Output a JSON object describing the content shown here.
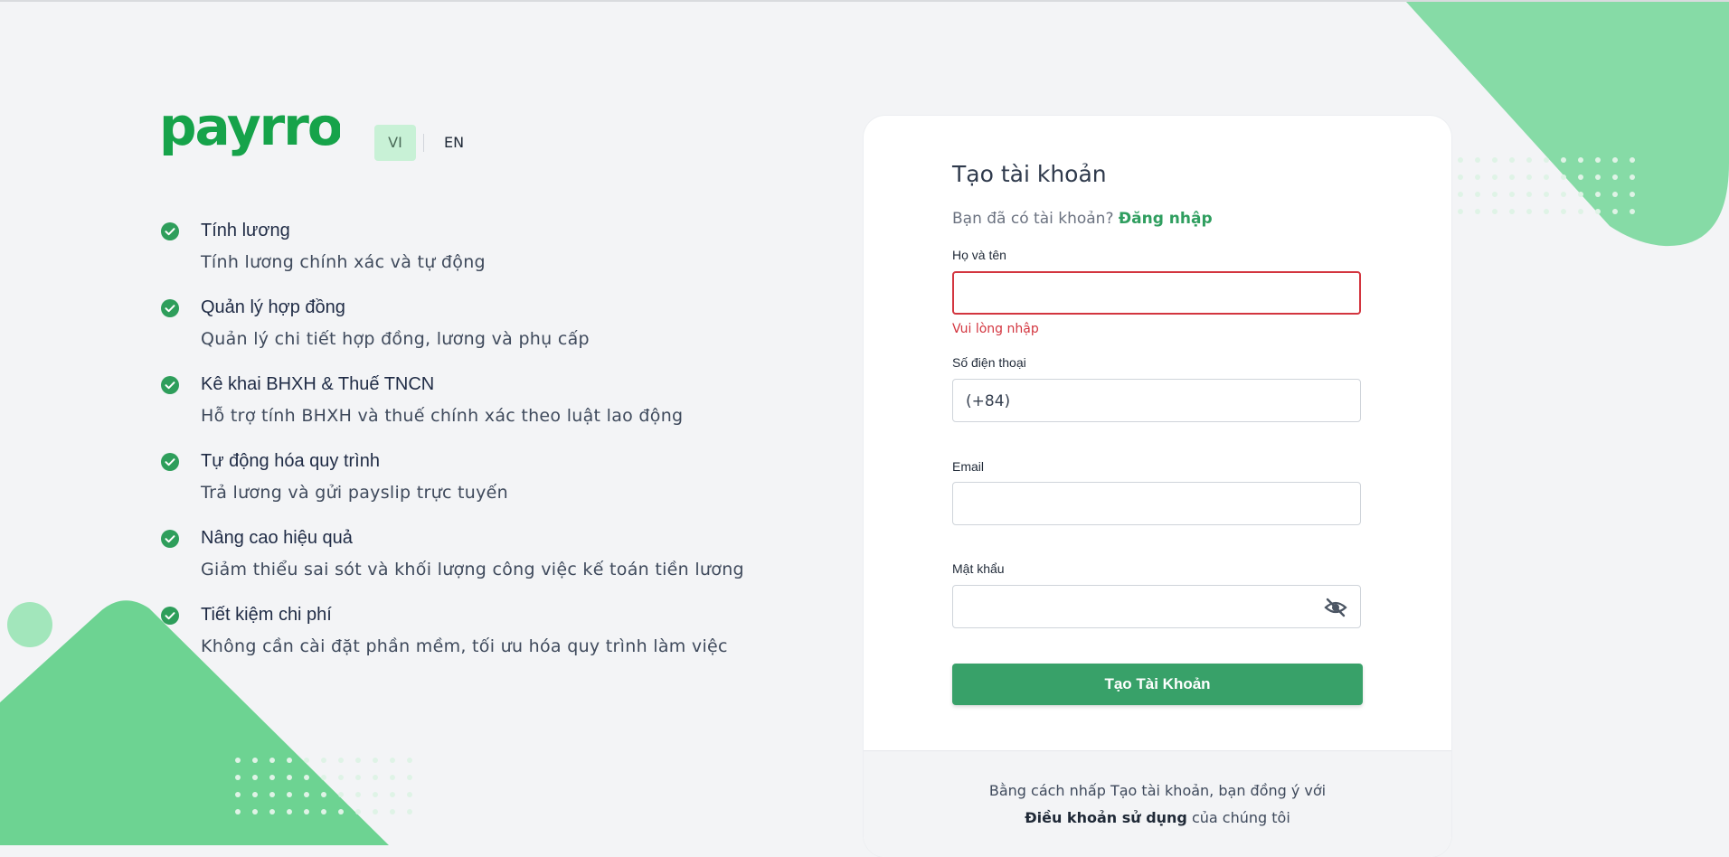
{
  "brand": {
    "logo_text": "payrro",
    "color": "#16a34a"
  },
  "language": {
    "vi": "VI",
    "en": "EN",
    "active": "VI"
  },
  "features": [
    {
      "title": "Tính lương",
      "desc": "Tính lương chính xác và tự động"
    },
    {
      "title": "Quản lý hợp đồng",
      "desc": "Quản lý chi tiết hợp đồng, lương và phụ cấp"
    },
    {
      "title": "Kê khai BHXH & Thuế TNCN",
      "desc": "Hỗ trợ tính BHXH và thuế chính xác theo luật lao động"
    },
    {
      "title": "Tự động hóa quy trình",
      "desc": "Trả lương và gửi payslip trực tuyến"
    },
    {
      "title": "Nâng cao hiệu quả",
      "desc": "Giảm thiểu sai sót và khối lượng công việc kế toán tiền lương"
    },
    {
      "title": "Tiết kiệm chi phí",
      "desc": "Không cần cài đặt phần mềm, tối ưu hóa quy trình làm việc"
    }
  ],
  "form": {
    "title": "Tạo tài khoản",
    "have_account": "Bạn đã có tài khoản?",
    "login_link": "Đăng nhập",
    "fullname_label": "Họ và tên",
    "fullname_value": "",
    "fullname_error": "Vui lòng nhập",
    "phone_label": "Số điện thoại",
    "phone_prefix": "(+84)",
    "email_label": "Email",
    "email_value": "",
    "password_label": "Mật khẩu",
    "password_value": "",
    "submit_label": "Tạo Tài Khoản"
  },
  "footer": {
    "line1": "Bằng cách nhấp Tạo tài khoản, bạn đồng ý với",
    "terms_link": "Điều khoản sử dụng",
    "line2_suffix": " của chúng tôi"
  },
  "colors": {
    "accent": "#38a169",
    "error": "#d3353f",
    "decor_green": "#6fd394",
    "check_green": "#2e9e5b"
  },
  "icons": {
    "feature_check": "check-circle-icon",
    "password_toggle": "eye-off-icon"
  }
}
